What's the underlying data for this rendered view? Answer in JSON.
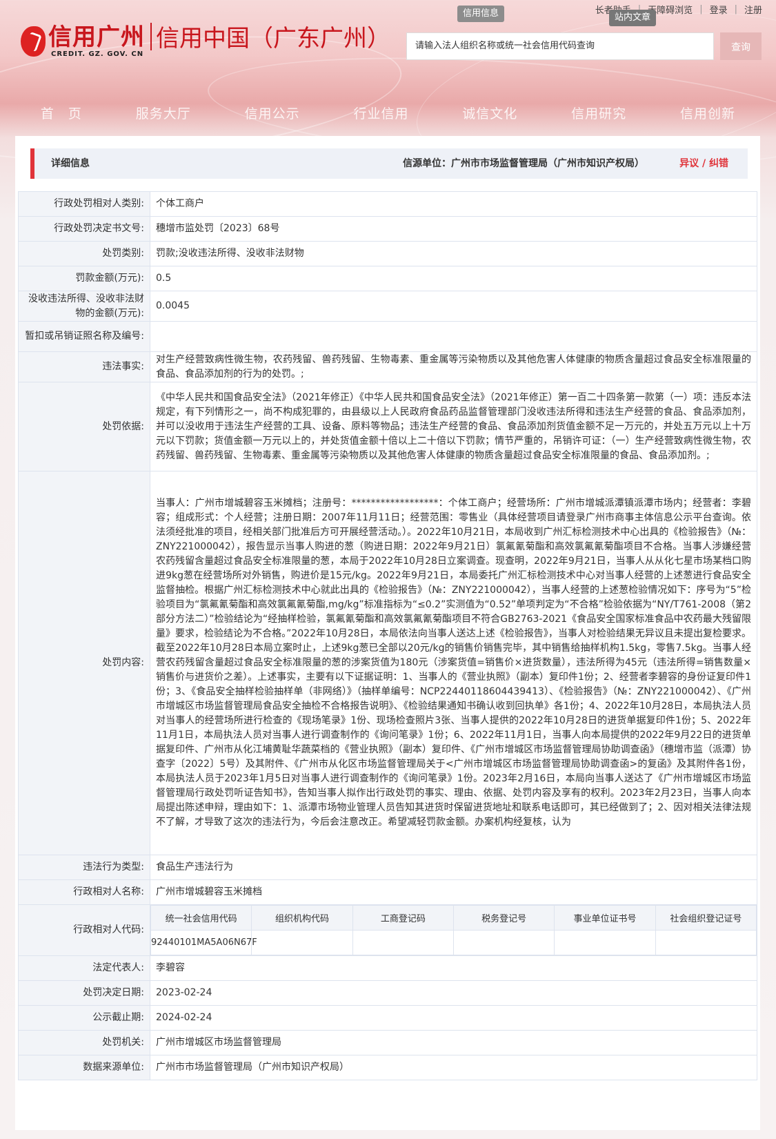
{
  "topbar": {
    "elder_helper": "长者助手",
    "barrier_free": "无障碍浏览",
    "login": "登录",
    "register": "注册"
  },
  "header": {
    "logo_cn": "信用广州",
    "logo_en": "CREDIT. GZ. GOV. CN",
    "subtitle": "信用中国（广东广州）",
    "tab_credit_info": "信用信息",
    "tab_site_article": "站内文章",
    "search_placeholder": "请输入法人组织名称或统一社会信用代码查询",
    "search_button": "查询"
  },
  "nav": [
    "首　页",
    "服务大厅",
    "信用公示",
    "行业信用",
    "诚信文化",
    "信用研究",
    "信用创新"
  ],
  "detail": {
    "title": "详细信息",
    "source": "信源单位：广州市市场监督管理局（广州市知识产权局）",
    "objection": "异议 / 纠错"
  },
  "rows": {
    "party_category": {
      "label": "行政处罚相对人类别:",
      "value": "个体工商户"
    },
    "decision_no": {
      "label": "行政处罚决定书文号:",
      "value": "穗增市监处罚〔2023〕68号"
    },
    "penalty_type": {
      "label": "处罚类别:",
      "value": "罚款;没收违法所得、没收非法财物"
    },
    "fine_amount": {
      "label": "罚款金额(万元):",
      "value": "0.5"
    },
    "confiscated_amount": {
      "label": "没收违法所得、没收非法财物的金额(万元):",
      "value": "0.0045"
    },
    "license_revoked": {
      "label": "暂扣或吊销证照名称及编号:",
      "value": ""
    },
    "facts": {
      "label": "违法事实:",
      "value": "对生产经营致病性微生物，农药残留、兽药残留、生物毒素、重金属等污染物质以及其他危害人体健康的物质含量超过食品安全标准限量的食品、食品添加剂的行为的处罚。;"
    },
    "basis": {
      "label": "处罚依据:",
      "value": "《中华人民共和国食品安全法》（2021年修正）《中华人民共和国食品安全法》（2021年修正）第一百二十四条第一款第（一）项：违反本法规定，有下列情形之一，尚不构成犯罪的，由县级以上人民政府食品药品监督管理部门没收违法所得和违法生产经营的食品、食品添加剂，并可以没收用于违法生产经营的工具、设备、原料等物品；违法生产经营的食品、食品添加剂货值金额不足一万元的，并处五万元以上十万元以下罚款；货值金额一万元以上的，并处货值金额十倍以上二十倍以下罚款；情节严重的，吊销许可证：（一）生产经营致病性微生物，农药残留、兽药残留、生物毒素、重金属等污染物质以及其他危害人体健康的物质含量超过食品安全标准限量的食品、食品添加剂。;"
    },
    "content": {
      "label": "处罚内容:",
      "value": "当事人：广州市增城碧容玉米摊档；注册号：******************：个体工商户；经营场所：广州市增城派潭镇派潭市场内；经营者：李碧容；组成形式：个人经营；注册日期：2007年11月11日；经营范围：零售业（具体经营项目请登录广州市商事主体信息公示平台查询。依法须经批准的项目，经相关部门批准后方可开展经营活动。）。2022年10月21日，本局收到广州汇标检测技术中心出具的《检验报告》（№：ZNY221000042），报告显示当事人购进的葱（购进日期：2022年9月21日）氯氟氰菊酯和高效氯氟氰菊酯项目不合格。当事人涉嫌经营农药残留含量超过食品安全标准限量的葱，本局于2022年10月28日立案调查。现查明，2022年9月21日，当事人从从化七星市场某档口购进9kg葱在经营场所对外销售，购进价是15元/kg。2022年9月21日，本局委托广州汇标检测技术中心对当事人经营的上述葱进行食品安全监督抽检。根据广州汇标检测技术中心就此出具的《检验报告》（№：ZNY221000042），当事人经营的上述葱检验情况如下：序号为“5”检验项目为“氯氟氰菊酯和高效氯氟氰菊酯,mg/kg”标准指标为“≤0.2”实测值为“0.52”单项判定为“不合格”检验依据为“NY/T761-2008（第2部分方法二）”检验结论为“经抽样检验，氯氟氰菊酯和高效氯氟氰菊酯项目不符合GB2763-2021《食品安全国家标准食品中农药最大残留限量》要求，检验结论为不合格。”2022年10月28日，本局依法向当事人送达上述《检验报告》，当事人对检验结果无异议且未提出复检要求。截至2022年10月28日本局立案时止，上述9kg葱已全部以20元/kg的销售价销售完毕，其中销售给抽样机构1.5kg，零售7.5kg。当事人经营农药残留含量超过食品安全标准限量的葱的涉案货值为180元（涉案货值=销售价×进货数量），违法所得为45元（违法所得=销售数量×销售价与进货价之差）。上述事实，主要有以下证据证明：1、当事人的《营业执照》（副本）复印件1份；2、经营者李碧容的身份证复印件1份；3、《食品安全抽样检验抽样单（非网络）》（抽样单编号：NCP22440118604439413）、《检验报告》（№：ZNY221000042）、《广州市增城区市场监督管理局食品安全抽检不合格报告说明》、《检验结果通知书确认收到回执单》各1份；4、2022年10月28日，本局执法人员对当事人的经营场所进行检查的《现场笔录》1份、现场检查照片3张、当事人提供的2022年10月28日的进货单据复印件1份；5、2022年11月1日，本局执法人员对当事人进行调查制作的《询问笔录》1份；6、2022年11月1日，当事人向本局提供的2022年9月22日的进货单据复印件、广州市从化江埔黄耻华蔬菜档的《营业执照》（副本）复印件、《广州市增城区市场监督管理局协助调查函》（穗增市监（派潭）协查字〔2022〕5号）及其附件、《广州市从化区市场监督管理局关于<广州市增城区市场监督管理局协助调查函>的复函》及其附件各1份，本局执法人员于2023年1月5日对当事人进行调查制作的《询问笔录》1份。2023年2月16日，本局向当事人送达了《广州市增城区市场监督管理局行政处罚听证告知书》，告知当事人拟作出行政处罚的事实、理由、依据、处罚内容及享有的权利。2023年2月23日，当事人向本局提出陈述申辩，理由如下：1、派潭市场物业管理人员告知其进货时保留进货地址和联系电话即可，其已经做到了；2、因对相关法律法规不了解，才导致了这次的违法行为，今后会注意改正。希望减轻罚款金额。办案机构经复核，认为"
    },
    "violation_type": {
      "label": "违法行为类型:",
      "value": "食品生产违法行为"
    },
    "party_name": {
      "label": "行政相对人名称:",
      "value": "广州市增城碧容玉米摊档"
    },
    "party_code": {
      "label": "行政相对人代码:"
    },
    "legal_rep": {
      "label": "法定代表人:",
      "value": "李碧容"
    },
    "decision_date": {
      "label": "处罚决定日期:",
      "value": "2023-02-24"
    },
    "publish_deadline": {
      "label": "公示截止期:",
      "value": "2024-02-24"
    },
    "authority": {
      "label": "处罚机关:",
      "value": "广州市增城区市场监督管理局"
    },
    "data_source": {
      "label": "数据来源单位:",
      "value": "广州市市场监督管理局（广州市知识产权局）"
    }
  },
  "codes": {
    "headers": [
      "统一社会信用代码",
      "组织机构代码",
      "工商登记码",
      "税务登记号",
      "事业单位证书号",
      "社会组织登记证号"
    ],
    "values": [
      "92440101MA5A06N67F",
      "",
      "",
      "",
      "",
      ""
    ]
  },
  "colors": {
    "accent": "#e0343a",
    "brand": "#c8161d",
    "label_bg": "#f2f4f8"
  }
}
